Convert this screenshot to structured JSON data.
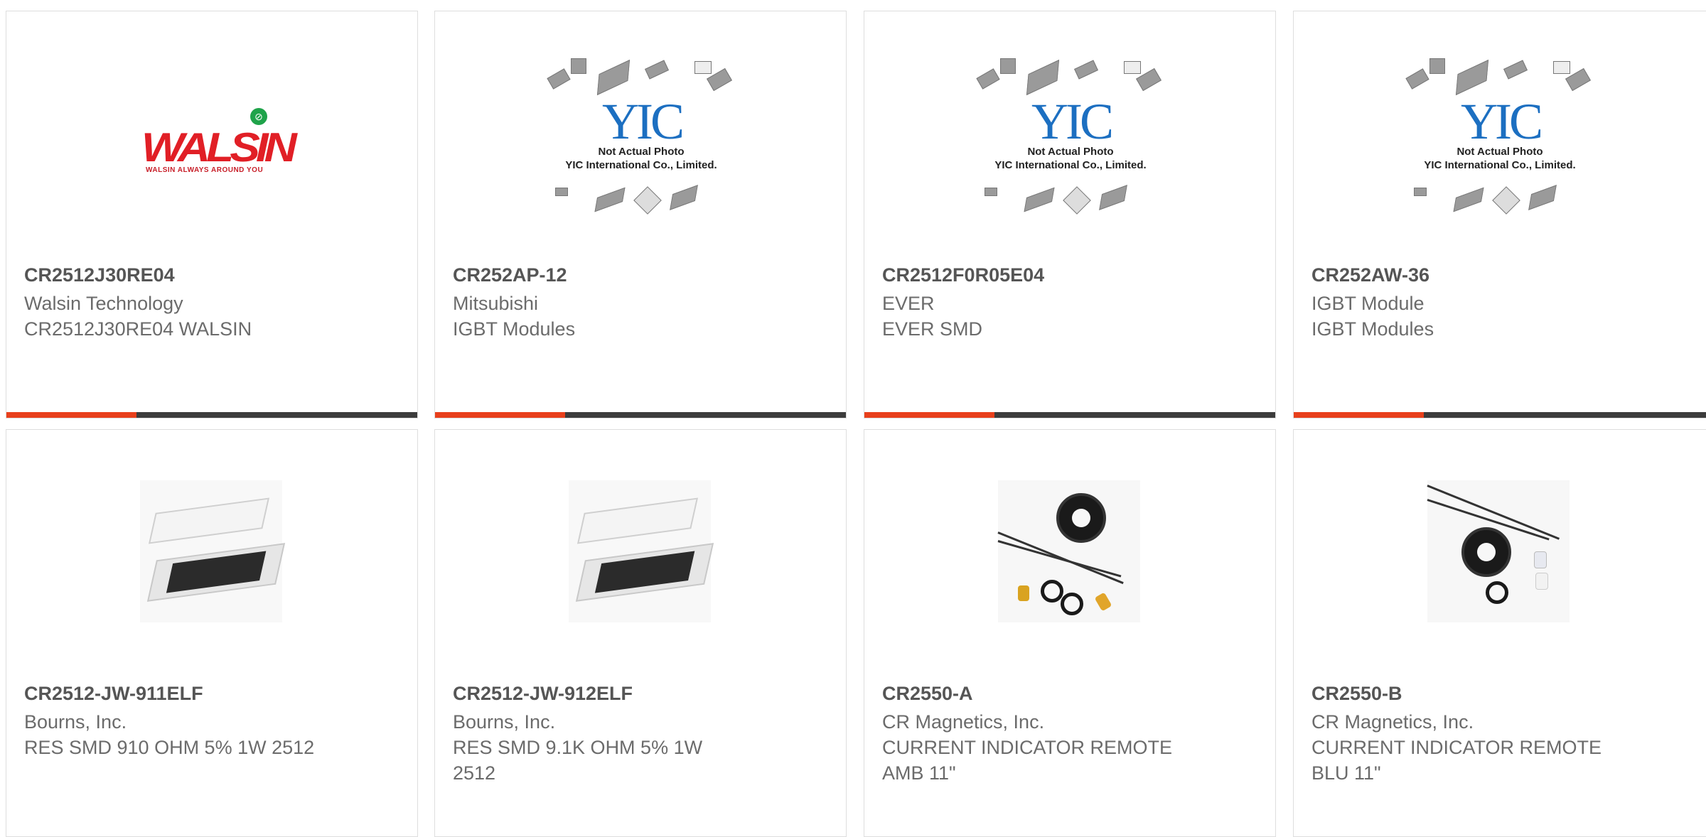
{
  "products": [
    {
      "part_number": "CR2512J30RE04",
      "manufacturer": "Walsin Technology",
      "description": "CR2512J30RE04 WALSIN",
      "image": "walsin-logo",
      "logo_text": "WALSIN",
      "logo_tagline": "WALSIN ALWAYS AROUND YOU"
    },
    {
      "part_number": "CR252AP-12",
      "manufacturer": "Mitsubishi",
      "description": "IGBT Modules",
      "image": "yic-placeholder",
      "logo_text": "YIC",
      "note_line1": "Not Actual Photo",
      "note_line2": "YIC International Co., Limited."
    },
    {
      "part_number": "CR2512F0R05E04",
      "manufacturer": "EVER",
      "description": "EVER SMD",
      "image": "yic-placeholder",
      "logo_text": "YIC",
      "note_line1": "Not Actual Photo",
      "note_line2": "YIC International Co., Limited."
    },
    {
      "part_number": "CR252AW-36",
      "manufacturer": "IGBT Module",
      "description": "IGBT Modules",
      "image": "yic-placeholder",
      "logo_text": "YIC",
      "note_line1": "Not Actual Photo",
      "note_line2": "YIC International Co., Limited."
    },
    {
      "part_number": "CR2512-JW-911ELF",
      "manufacturer": "Bourns, Inc.",
      "description": "RES SMD 910 OHM 5% 1W 2512",
      "image": "smd-resistor"
    },
    {
      "part_number": "CR2512-JW-912ELF",
      "manufacturer": "Bourns, Inc.",
      "description": "RES SMD 9.1K OHM 5% 1W 2512",
      "image": "smd-resistor"
    },
    {
      "part_number": "CR2550-A",
      "manufacturer": "CR Magnetics, Inc.",
      "description": "CURRENT INDICATOR REMOTE AMB 11\"",
      "image": "current-indicator-amber"
    },
    {
      "part_number": "CR2550-B",
      "manufacturer": "CR Magnetics, Inc.",
      "description": "CURRENT INDICATOR REMOTE BLU 11\"",
      "image": "current-indicator-blue"
    }
  ],
  "colors": {
    "accent": "#e8401c",
    "bar": "#3c3c3c",
    "walsin_red": "#e11f26",
    "yic_blue": "#1c6fc1"
  }
}
